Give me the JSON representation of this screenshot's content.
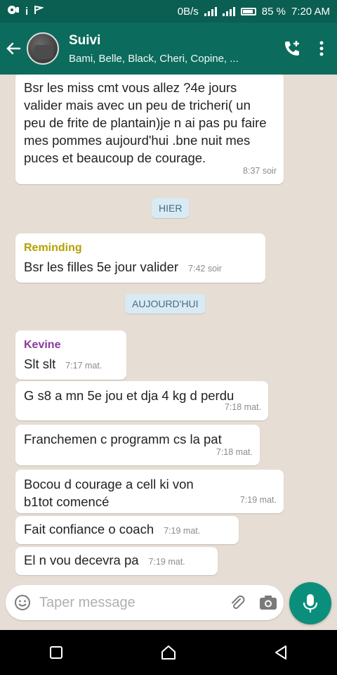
{
  "status": {
    "net_speed": "0B/s",
    "battery": "85 %",
    "time": "7:20 AM"
  },
  "header": {
    "title": "Suivi",
    "subtitle": "Bami, Belle, Black, Cheri, Copine, ..."
  },
  "messages": [
    {
      "sender": "",
      "text": "Bsr les miss cmt vous allez ?4e jours valider mais avec un peu de tricheri( un peu de frite de plantain)je n ai pas pu faire mes pommes aujourd'hui .bne nuit  mes puces et beaucoup de courage.",
      "time": "8:37 soir"
    },
    {
      "sender": "Reminding",
      "text": "Bsr les filles 5e jour valider",
      "time": "7:42 soir"
    },
    {
      "sender": "Kevine",
      "text": "Slt slt",
      "time": "7:17 mat."
    },
    {
      "sender": "",
      "text": "G s8 a mn 5e jou et dja 4 kg d perdu",
      "time": "7:18 mat."
    },
    {
      "sender": "",
      "text": "Franchemen c programm cs la pat",
      "time": "7:18 mat."
    },
    {
      "sender": "",
      "text": "Bocou d courage a cell ki von b1tot comencé",
      "time": "7:19 mat."
    },
    {
      "sender": "",
      "text": "Fait confiance o coach",
      "time": "7:19 mat."
    },
    {
      "sender": "",
      "text": "El n vou decevra pa",
      "time": "7:19 mat."
    }
  ],
  "dates": [
    "HIER",
    "AUJOURD'HUI"
  ],
  "input": {
    "placeholder": "Taper message"
  },
  "colors": {
    "header": "#0b6b5c",
    "status_bar": "#0b5e52",
    "accent": "#0b8f7c",
    "sender_reminding": "#b5a000",
    "sender_kevine": "#8a3a9c"
  },
  "icons": [
    "back-arrow-icon",
    "add-call-icon",
    "overflow-menu-icon",
    "emoji-icon",
    "attach-icon",
    "camera-icon",
    "mic-icon",
    "recents-icon",
    "home-icon",
    "back-icon"
  ]
}
